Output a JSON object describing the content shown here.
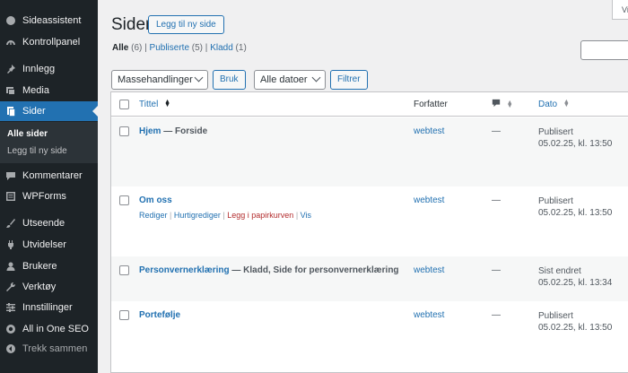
{
  "sidebar": {
    "items": [
      {
        "label": "Sideassistent",
        "icon": "site-assistant-icon"
      },
      {
        "label": "Kontrollpanel",
        "icon": "dashboard-icon"
      },
      {
        "label": "Innlegg",
        "icon": "pin-icon"
      },
      {
        "label": "Media",
        "icon": "media-icon"
      },
      {
        "label": "Sider",
        "icon": "pages-icon"
      },
      {
        "label": "Kommentarer",
        "icon": "comments-icon"
      },
      {
        "label": "WPForms",
        "icon": "wpforms-icon"
      },
      {
        "label": "Utseende",
        "icon": "brush-icon"
      },
      {
        "label": "Utvidelser",
        "icon": "plugin-icon"
      },
      {
        "label": "Brukere",
        "icon": "users-icon"
      },
      {
        "label": "Verktøy",
        "icon": "wrench-icon"
      },
      {
        "label": "Innstillinger",
        "icon": "settings-icon"
      },
      {
        "label": "All in One SEO",
        "icon": "seo-icon"
      }
    ],
    "submenu": [
      "Alle sider",
      "Legg til ny side"
    ],
    "collapse_label": "Trekk sammen"
  },
  "header": {
    "title": "Sider",
    "add_new": "Legg til ny side",
    "screen_options": "Vi"
  },
  "views": {
    "all": "Alle",
    "all_count": "(6)",
    "published": "Publiserte",
    "published_count": "(5)",
    "draft": "Kladd",
    "draft_count": "(1)",
    "sep": "|"
  },
  "toolbar": {
    "bulk_actions": "Massehandlinger",
    "apply": "Bruk",
    "dates": "Alle datoer",
    "filter": "Filtrer"
  },
  "table": {
    "headers": {
      "title": "Tittel",
      "author": "Forfatter",
      "date": "Dato"
    },
    "rows": [
      {
        "title": "Hjem",
        "state": " — Forside",
        "author": "webtest",
        "comments": "—",
        "status": "Publisert",
        "date": "05.02.25, kl. 13:50"
      },
      {
        "title": "Om oss",
        "state": "",
        "author": "webtest",
        "comments": "—",
        "status": "Publisert",
        "date": "05.02.25, kl. 13:50",
        "actions": {
          "edit": "Rediger",
          "quick_edit": "Hurtigrediger",
          "trash": "Legg i papirkurven",
          "view": "Vis",
          "sep": " | "
        }
      },
      {
        "title": "Personvernerklæring",
        "state": " — Kladd, Side for personvernerklæring",
        "author": "webtest",
        "comments": "—",
        "status": "Sist endret",
        "date": "05.02.25, kl. 13:34"
      },
      {
        "title": "Portefølje",
        "state": "",
        "author": "webtest",
        "comments": "—",
        "status": "Publisert",
        "date": "05.02.25, kl. 13:50"
      }
    ]
  },
  "colors": {
    "admin_bar": "#1d2327",
    "accent": "#2271b1",
    "trash": "#b32d2e"
  }
}
